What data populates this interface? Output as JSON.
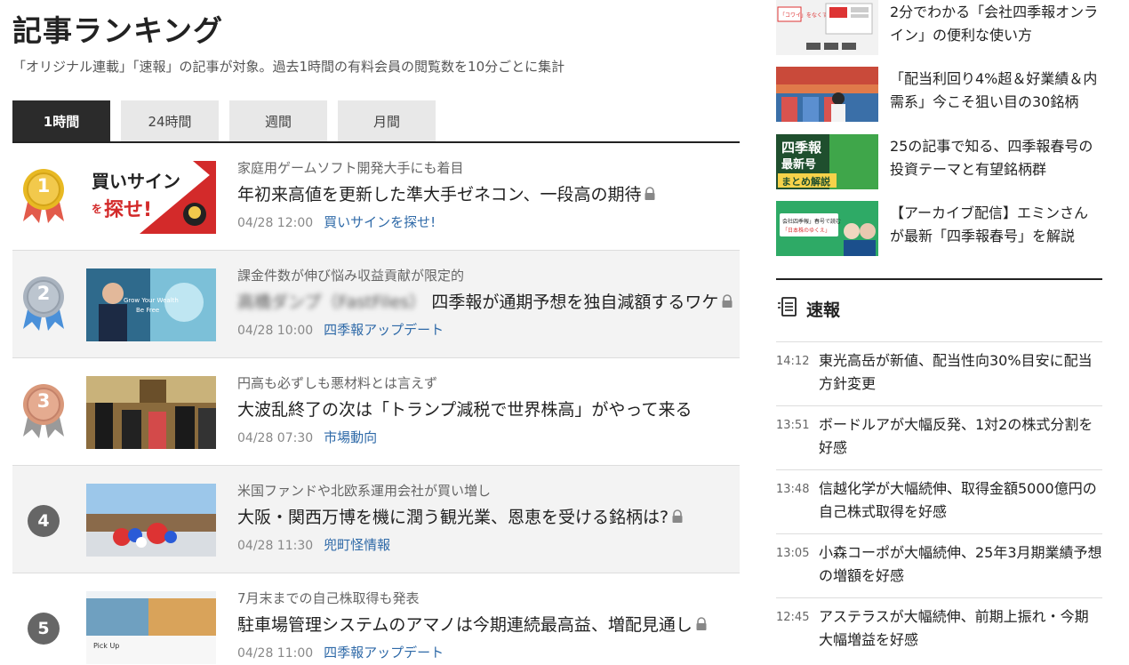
{
  "ranking": {
    "title": "記事ランキング",
    "description": "「オリジナル連載」「速報」の記事が対象。過去1時間の有料会員の閲覧数を10分ごとに集計",
    "tabs": [
      "1時間",
      "24時間",
      "週間",
      "月間"
    ],
    "active_tab": "1時間",
    "items": [
      {
        "rank": "1",
        "subtitle": "家庭用ゲームソフト開発大手にも着目",
        "headline": "年初来高値を更新した準大手ゼネコン、一段高の期待",
        "locked": true,
        "date": "04/28 12:00",
        "category": "買いサインを探せ!"
      },
      {
        "rank": "2",
        "subtitle": "課金件数が伸び悩み収益貢献が限定的",
        "headline_blurred": "高橋ダンプ（FastFiles）",
        "headline": "四季報が通期予想を独自減額するワケ",
        "locked": true,
        "date": "04/28 10:00",
        "category": "四季報アップデート"
      },
      {
        "rank": "3",
        "subtitle": "円高も必ずしも悪材料とは言えず",
        "headline": "大波乱終了の次は「トランプ減税で世界株高」がやって来る",
        "locked": false,
        "date": "04/28 07:30",
        "category": "市場動向"
      },
      {
        "rank": "4",
        "subtitle": "米国ファンドや北欧系運用会社が買い増し",
        "headline": "大阪・関西万博を機に潤う観光業、恩恵を受ける銘柄は?",
        "locked": true,
        "date": "04/28 11:30",
        "category": "兜町怪情報"
      },
      {
        "rank": "5",
        "subtitle": "7月末までの自己株取得も発表",
        "headline": "駐車場管理システムのアマノは今期連続最高益、増配見通し",
        "locked": true,
        "date": "04/28 11:00",
        "category": "四季報アップデート"
      }
    ],
    "thumb1_text": [
      "買いサイン",
      "を",
      "探せ!"
    ],
    "thumb2_text": [
      "Grow Your Wealth",
      "Be Free"
    ],
    "thumb5_text": [
      "Pick Up"
    ]
  },
  "sidebar": {
    "promos": [
      {
        "text": "2分でわかる「会社四季報オンライン」の便利な使い方",
        "thumb_label": "「コワイ」をなくす"
      },
      {
        "text": "「配当利回り4%超＆好業績＆内需系」今こそ狙い目の30銘柄"
      },
      {
        "text": "25の記事で知る、四季報春号の投資テーマと有望銘柄群",
        "thumb_lines": [
          "四季報",
          "最新号",
          "まとめ解説"
        ]
      },
      {
        "text": "【アーカイブ配信】エミンさんが最新「四季報春号」を解説",
        "thumb_lines": [
          "会社四季報」春号で読む",
          "「日本株のゆくえ」"
        ]
      }
    ],
    "flash": {
      "title": "速報",
      "items": [
        {
          "time": "14:12",
          "text": "東光高岳が新値、配当性向30%目安に配当方針変更"
        },
        {
          "time": "13:51",
          "text": "ボードルアが大幅反発、1対2の株式分割を好感"
        },
        {
          "time": "13:48",
          "text": "信越化学が大幅続伸、取得金額5000億円の自己株式取得を好感"
        },
        {
          "time": "13:05",
          "text": "小森コーポが大幅続伸、25年3月期業績予想の増額を好感"
        },
        {
          "time": "12:45",
          "text": "アステラスが大幅続伸、前期上振れ・今期大幅増益を好感"
        }
      ]
    }
  },
  "colors": {
    "gold": "#e8b923",
    "silver": "#a9b3bf",
    "bronze": "#d9987a",
    "link": "#2f6aa8",
    "tab_active": "#2b2b2b"
  }
}
